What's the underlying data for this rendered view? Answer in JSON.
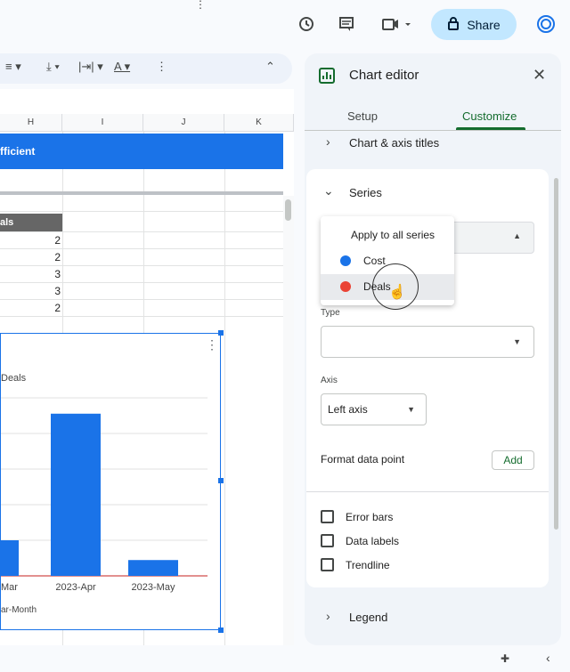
{
  "topbar": {
    "history_icon": "history-icon",
    "comment_icon": "comment-icon",
    "meet_icon": "video-camera-icon",
    "share_label": "Share",
    "colors": {
      "share_bg": "#c2e7ff"
    }
  },
  "toolbar": {
    "tools": [
      "text-format",
      "valign",
      "text-wrap",
      "text-color",
      "more"
    ]
  },
  "sheet": {
    "columns": [
      "H",
      "I",
      "J",
      "K"
    ],
    "banner_text": "fficient",
    "deals_header": "als",
    "deals_values": [
      "2",
      "2",
      "3",
      "3",
      "2"
    ]
  },
  "chart": {
    "legend_label": "Deals",
    "xaxis_title": "ar-Month"
  },
  "chart_data": {
    "type": "bar",
    "categories": [
      "Mar",
      "2023-Apr",
      "2023-May"
    ],
    "series": [
      {
        "name": "Deals",
        "values": [
          0.9,
          4.1,
          0.4
        ]
      }
    ],
    "xlabel": "ar-Month",
    "colors": [
      "#1a73e8"
    ]
  },
  "panel": {
    "title": "Chart editor",
    "tabs": [
      "Setup",
      "Customize"
    ],
    "active_tab": "Customize",
    "sections": {
      "chart_axis_titles": "Chart & axis titles",
      "series": "Series",
      "legend": "Legend"
    },
    "dropdown": {
      "apply_all": "Apply to all series",
      "items": [
        {
          "label": "Cost",
          "color": "#1a73e8"
        },
        {
          "label": "Deals",
          "color": "#ea4335"
        }
      ]
    },
    "type_label": "Type",
    "axis_label": "Axis",
    "axis_value": "Left axis",
    "format_point_label": "Format data point",
    "add_label": "Add",
    "checkboxes": [
      "Error bars",
      "Data labels",
      "Trendline"
    ],
    "accent": "#146c2e"
  }
}
